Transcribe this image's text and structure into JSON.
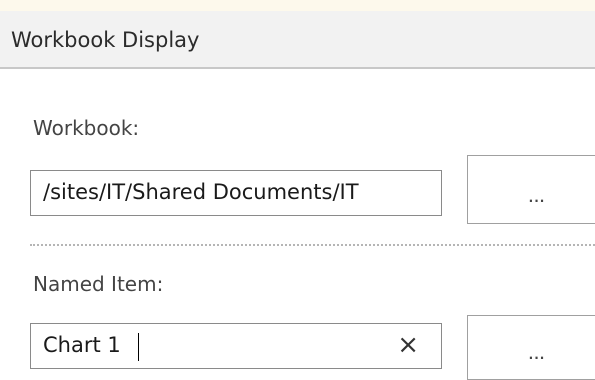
{
  "header": {
    "title": "Workbook Display"
  },
  "workbook": {
    "label": "Workbook:",
    "value": "/sites/IT/Shared Documents/IT",
    "browse_label": "..."
  },
  "named_item": {
    "label": "Named Item:",
    "value": "Chart 1",
    "clear_icon": "×",
    "browse_label": "..."
  }
}
